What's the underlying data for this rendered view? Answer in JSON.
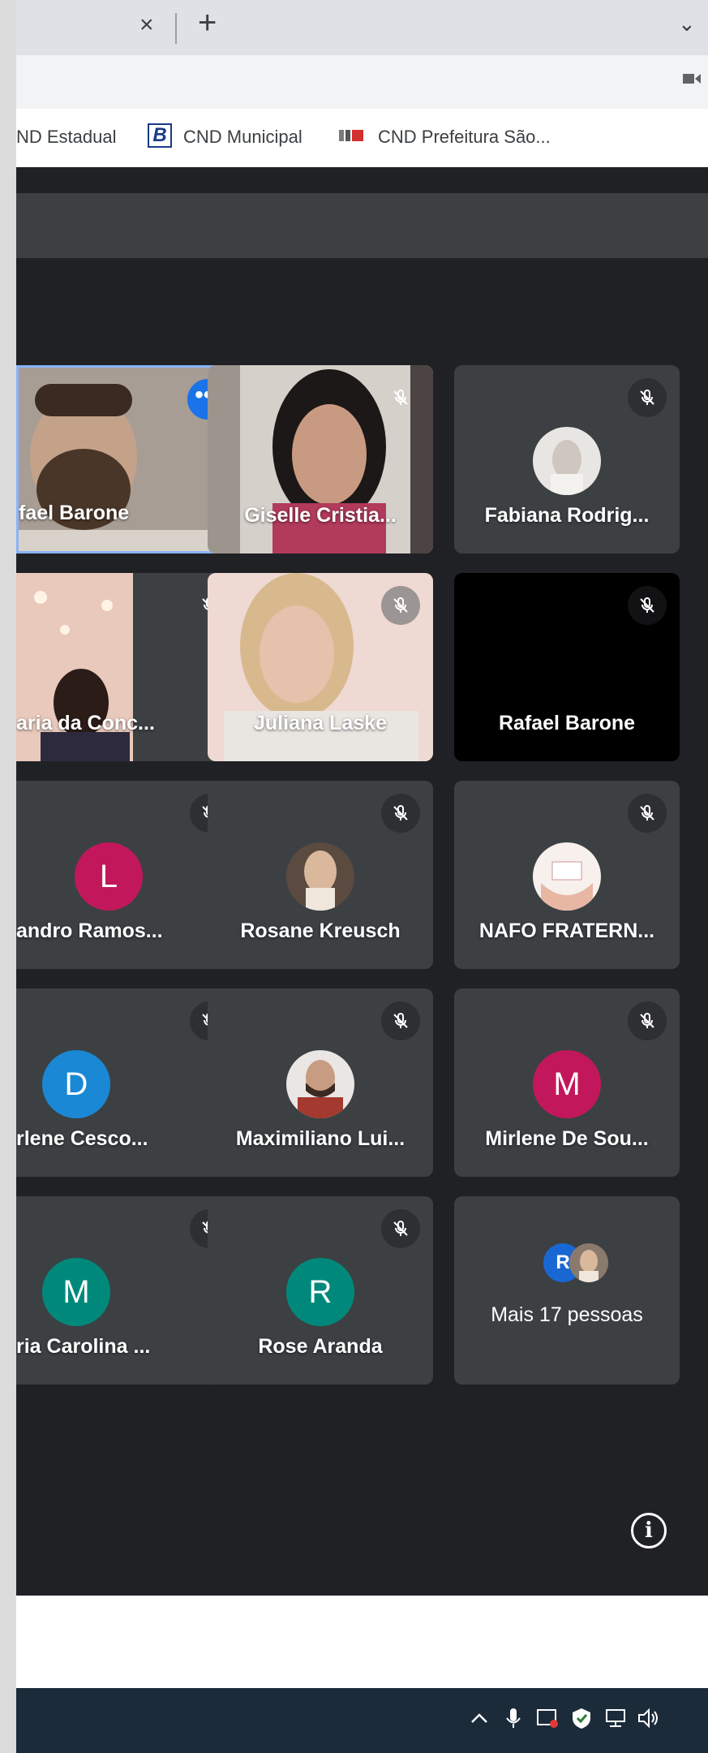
{
  "browser": {
    "tab_close_glyph": "×",
    "new_tab_glyph": "+",
    "tab_menu_glyph": "⌄"
  },
  "bookmarks": [
    {
      "label": "ND Estadual"
    },
    {
      "label": "CND Municipal"
    },
    {
      "label": "CND Prefeitura São..."
    }
  ],
  "bookmark_b_glyph": "B",
  "meeting": {
    "more_options_glyph": "•••",
    "info_glyph": "i",
    "tiles": [
      {
        "name": "fael Barone",
        "type": "video"
      },
      {
        "name": "Giselle Cristia...",
        "type": "video"
      },
      {
        "name": "Fabiana Rodrig...",
        "type": "avatar-photo"
      },
      {
        "name": "aria da Conc...",
        "type": "video"
      },
      {
        "name": "Juliana Laske",
        "type": "video"
      },
      {
        "name": "Rafael Barone",
        "type": "black"
      },
      {
        "name": "andro Ramos...",
        "type": "letter",
        "initial": "L",
        "color": "#c2185b"
      },
      {
        "name": "Rosane Kreusch",
        "type": "avatar-photo"
      },
      {
        "name": "NAFO FRATERN...",
        "type": "avatar-photo"
      },
      {
        "name": "rlene Cesco...",
        "type": "letter",
        "initial": "D",
        "color": "#1a88d4"
      },
      {
        "name": "Maximiliano Lui...",
        "type": "avatar-photo"
      },
      {
        "name": "Mirlene De Sou...",
        "type": "letter",
        "initial": "M",
        "color": "#c2185b"
      },
      {
        "name": "ria Carolina ...",
        "type": "letter",
        "initial": "M",
        "color": "#00897b"
      },
      {
        "name": "Rose Aranda",
        "type": "letter",
        "initial": "R",
        "color": "#00897b"
      }
    ],
    "more_people": {
      "label": "Mais 17 pessoas",
      "initial": "R",
      "color": "#1967d2"
    }
  },
  "colors": {
    "meet_bg": "#202124",
    "tile_bg": "#3c4043",
    "active_border": "#8ab4f8",
    "accent": "#1a73e8"
  }
}
